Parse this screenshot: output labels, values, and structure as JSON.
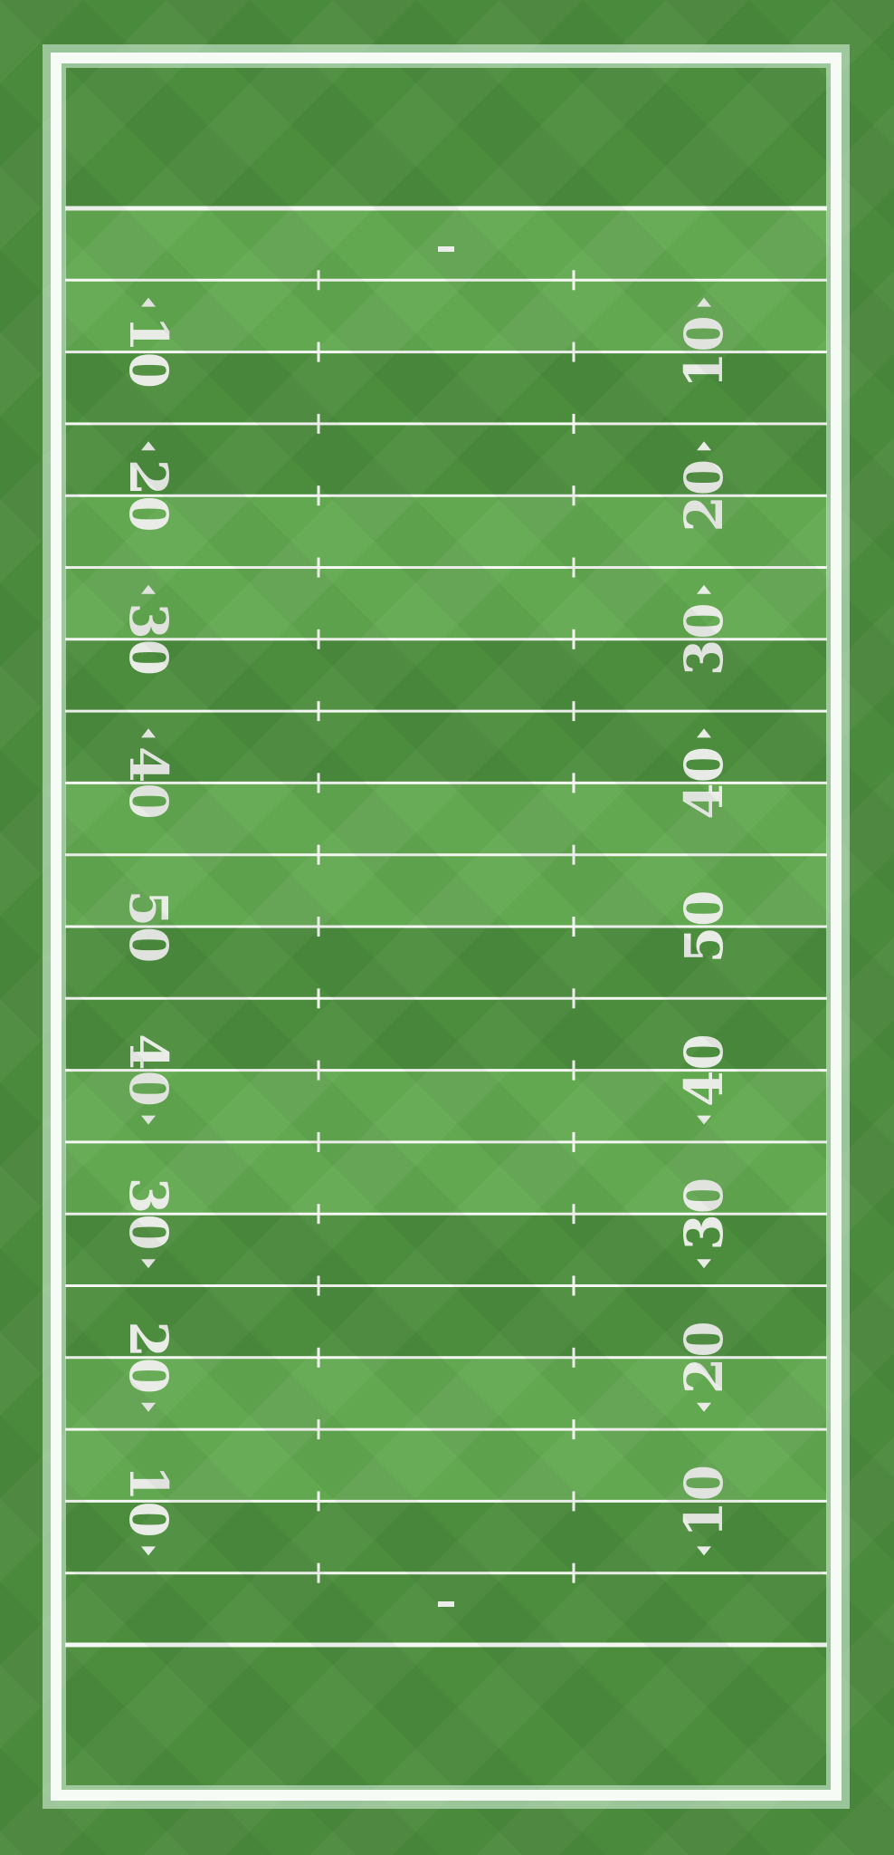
{
  "field": {
    "colors": {
      "outer_grass": "#4a8a3c",
      "dark_stripe": "#4b8c3d",
      "light_stripe": "#62a850",
      "end_zone": "#4f9040",
      "line": "#f4f7f1",
      "numbers": "#e9ece6",
      "boundary_glow": "#dff7e8"
    },
    "orientation": "vertical",
    "yard_numbers": [
      {
        "label": "10",
        "arrow": "top"
      },
      {
        "label": "20",
        "arrow": "top"
      },
      {
        "label": "30",
        "arrow": "top"
      },
      {
        "label": "40",
        "arrow": "top"
      },
      {
        "label": "50",
        "arrow": "none"
      },
      {
        "label": "40",
        "arrow": "bottom"
      },
      {
        "label": "30",
        "arrow": "bottom"
      },
      {
        "label": "20",
        "arrow": "bottom"
      },
      {
        "label": "10",
        "arrow": "bottom"
      }
    ],
    "end_zones": [
      "top",
      "bottom"
    ],
    "two_point_marks": [
      "top",
      "bottom"
    ],
    "icons": [
      "yard-arrow-icon"
    ]
  }
}
